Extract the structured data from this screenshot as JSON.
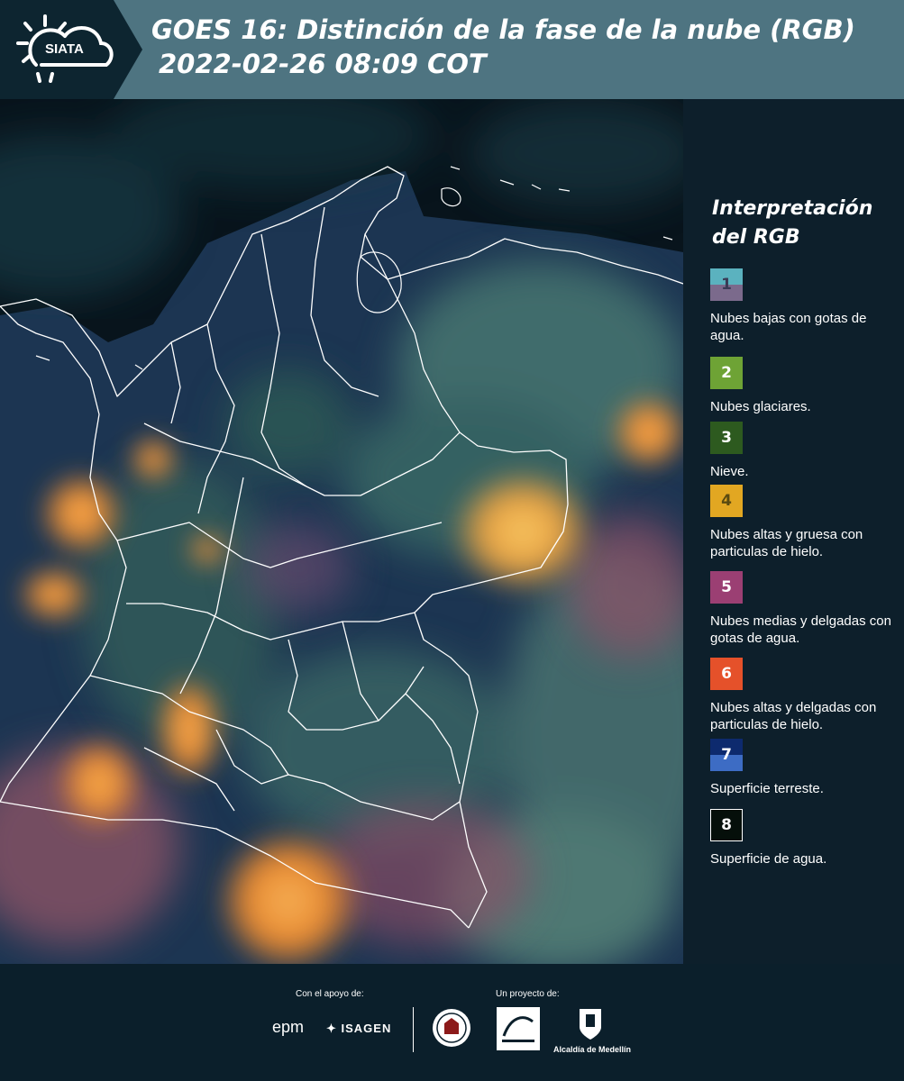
{
  "header": {
    "logo_text": "SIATA",
    "title_line1": "GOES 16: Distinción de la fase de la nube (RGB)",
    "title_line2": "2022-02-26 08:09 COT"
  },
  "legend": {
    "title_line1": "Interpretación",
    "title_line2": "del RGB",
    "items": [
      {
        "num": "1",
        "label": "Nubes bajas con gotas de agua.",
        "color_top": "#5bb2bf",
        "color_bottom": "#7b6a8c"
      },
      {
        "num": "2",
        "label": "Nubes glaciares.",
        "color_top": "#6ea335",
        "color_bottom": "#6ea335"
      },
      {
        "num": "3",
        "label": "Nieve.",
        "color_top": "#2d5a1f",
        "color_bottom": "#2d5a1f"
      },
      {
        "num": "4",
        "label": "Nubes altas y gruesa con particulas de hielo.",
        "color_top": "#e2a722",
        "color_bottom": "#e2a722"
      },
      {
        "num": "5",
        "label": "Nubes medias y delgadas con gotas de agua.",
        "color_top": "#9b3f73",
        "color_bottom": "#9b3f73"
      },
      {
        "num": "6",
        "label": "Nubes altas y delgadas con particulas de hielo.",
        "color_top": "#e5512a",
        "color_bottom": "#e5512a"
      },
      {
        "num": "7",
        "label": "Superficie terreste.",
        "color_top": "#0d2a6e",
        "color_bottom": "#3d6cc4"
      },
      {
        "num": "8",
        "label": "Superficie de agua.",
        "color_top": "#050f0a",
        "color_bottom": "#050f0a"
      }
    ]
  },
  "footer": {
    "support_label": "Con el apoyo de:",
    "project_label": "Un proyecto de:",
    "epm_text": "epm",
    "isagen_text": "ISAGEN",
    "alcaldia_text": "Alcaldía de Medellín"
  },
  "colors": {
    "header_bg": "#4e7481",
    "logo_bg": "#0d2530",
    "page_bg": "#0b1f2b",
    "ocean": "#0a1822",
    "land": "#1a3450",
    "cloud_orange": "#e8872e",
    "cloud_green": "#5f8f6a",
    "cloud_pink": "#b06470",
    "border": "#ffffff"
  }
}
